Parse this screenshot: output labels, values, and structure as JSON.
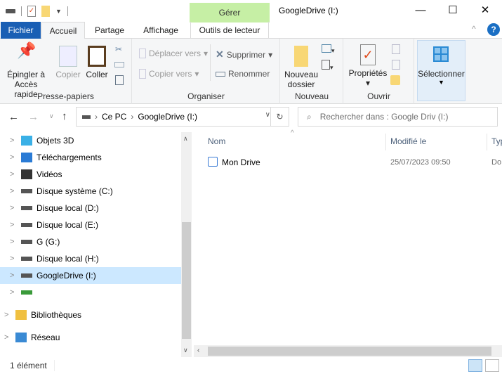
{
  "window": {
    "title": "GoogleDrive (I:)",
    "context_tab_group": "Gérer"
  },
  "tabs": [
    "Fichier",
    "Accueil",
    "Partage",
    "Affichage",
    "Outils de lecteur"
  ],
  "ribbon": {
    "presse_papiers": {
      "label": "Presse-papiers",
      "pin": "Épingler à",
      "pin2": "Accès rapide",
      "copy": "Copier",
      "paste": "Coller"
    },
    "organiser": {
      "label": "Organiser",
      "move": "Déplacer vers",
      "copy_to": "Copier vers",
      "delete": "Supprimer",
      "rename": "Renommer"
    },
    "nouveau": {
      "label": "Nouveau",
      "new_folder": "Nouveau",
      "new_folder2": "dossier"
    },
    "ouvrir": {
      "label": "Ouvrir",
      "properties": "Propriétés"
    },
    "select": {
      "label": "Sélectionner"
    }
  },
  "address": {
    "crumbs": [
      "Ce PC",
      "GoogleDrive (I:)"
    ],
    "search_placeholder": "Rechercher dans : Google Driv (I:)"
  },
  "nav": [
    "Objets 3D",
    "Téléchargements",
    "Vidéos",
    "Disque système (C:)",
    "Disque local (D:)",
    "Disque local (E:)",
    "G (G:)",
    "Disque local (H:)",
    "GoogleDrive (I:)",
    "",
    "Bibliothèques",
    "Réseau"
  ],
  "columns": [
    "Nom",
    "Modifié le",
    "Typ"
  ],
  "files": [
    {
      "name": "Mon Drive",
      "modified": "25/07/2023 09:50",
      "type": "Do"
    }
  ],
  "status": "1 élément"
}
